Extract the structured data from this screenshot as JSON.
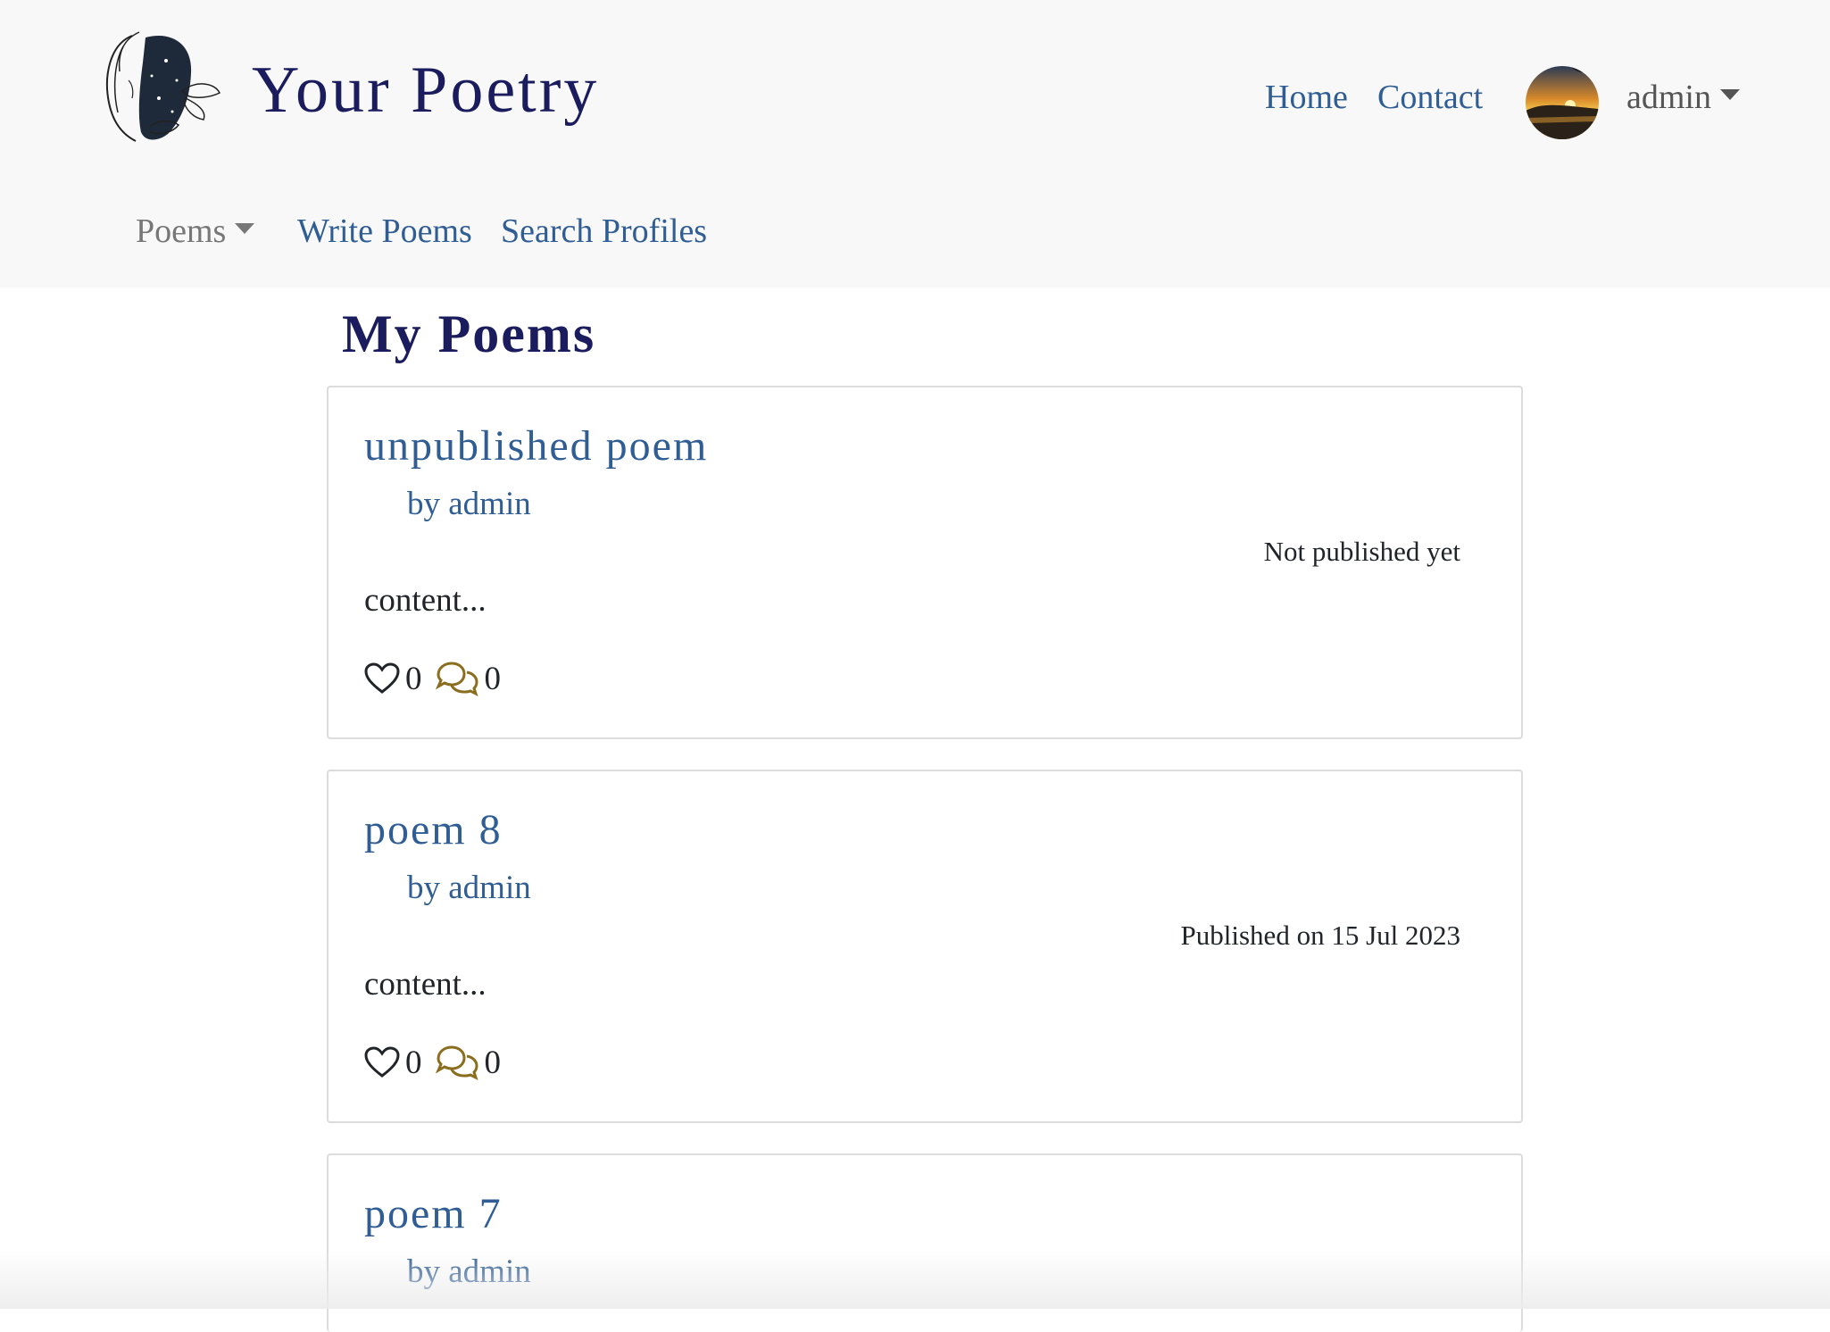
{
  "brand": {
    "title": "Your Poetry",
    "logo_icon": "woman-face-butterfly-logo"
  },
  "nav": {
    "home": "Home",
    "contact": "Contact",
    "user": "admin",
    "avatar_icon": "sunset-avatar"
  },
  "subnav": {
    "poems": "Poems",
    "write": "Write Poems",
    "search": "Search Profiles"
  },
  "page": {
    "title": "My Poems"
  },
  "poems": [
    {
      "title": "unpublished poem",
      "author": "by admin",
      "status": "Not published yet",
      "excerpt": "content...",
      "likes": "0",
      "comments": "0"
    },
    {
      "title": "poem 8",
      "author": "by admin",
      "status": "Published on 15 Jul 2023",
      "excerpt": "content...",
      "likes": "0",
      "comments": "0"
    },
    {
      "title": "poem 7",
      "author": "by admin"
    }
  ],
  "colors": {
    "brand": "#1a1c5e",
    "link": "#2f5d94",
    "muted": "#777777",
    "comment_icon": "#8a6d1e",
    "navbar_bg": "#f8f8f8"
  }
}
